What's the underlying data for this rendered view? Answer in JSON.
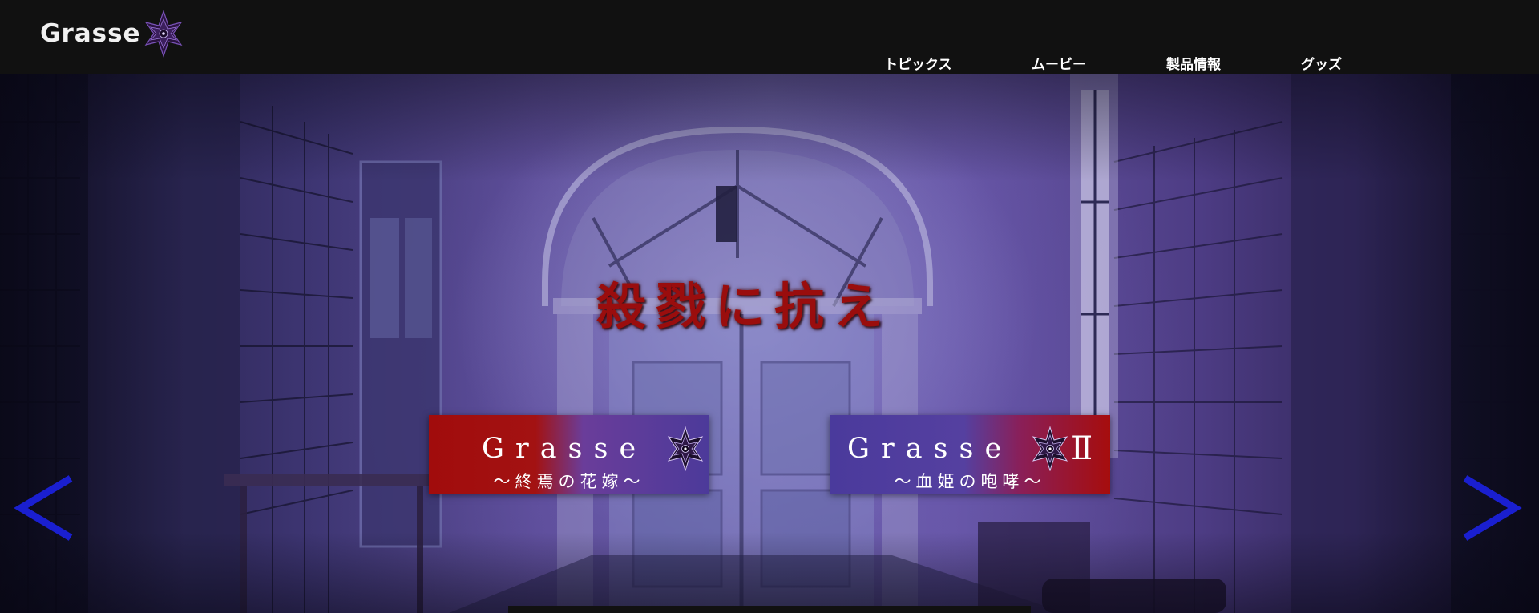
{
  "header": {
    "logo_text": "Grasse",
    "logo_icon": "hexagram-star-icon",
    "nav": [
      {
        "label": "トピックス"
      },
      {
        "label": "ムービー"
      },
      {
        "label": "製品情報"
      },
      {
        "label": "グッズ"
      }
    ]
  },
  "hero": {
    "tagline": "殺戮に抗え",
    "banners": [
      {
        "title": "Grasse",
        "subtitle": "〜終焉の花嫁〜",
        "icon": "hexagram-star-icon"
      },
      {
        "title": "Grasse",
        "numeral": "Ⅱ",
        "subtitle": "〜血姫の咆哮〜",
        "icon": "hexagram-star-icon"
      }
    ],
    "prev_icon": "chevron-left-icon",
    "next_icon": "chevron-right-icon"
  },
  "colors": {
    "header_bg": "#111111",
    "tagline_red": "#9a0d0d",
    "arrow_blue": "#1a1fd0",
    "banner_red": "#a10c0c",
    "banner_purple": "#4c3a9a"
  }
}
